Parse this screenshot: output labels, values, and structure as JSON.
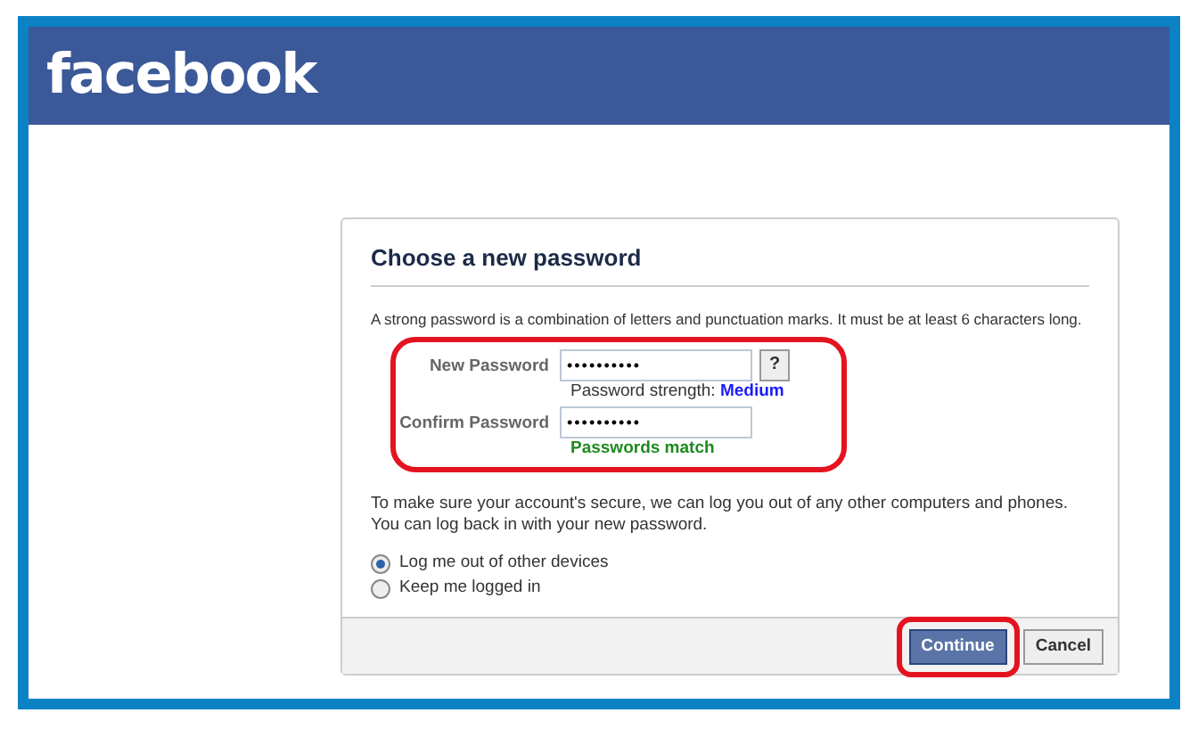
{
  "header": {
    "logo": "facebook"
  },
  "dialog": {
    "title": "Choose a new password",
    "intro": "A strong password is a combination of letters and punctuation marks. It must be at least 6 characters long.",
    "password_group": {
      "highlighted": true,
      "fields": [
        {
          "kind": "new",
          "label": "New Password",
          "value": "••••••••••",
          "help_button": "?",
          "hint_label": "Password strength:",
          "hint_value": "Medium"
        },
        {
          "kind": "confirm",
          "label": "Confirm Password",
          "value": "••••••••••",
          "hint_value": "Passwords match"
        }
      ]
    },
    "note": "To make sure your account's secure, we can log you out of any other computers and phones. You can log back in with your new password.",
    "options": [
      {
        "label": "Log me out of other devices",
        "selected": true
      },
      {
        "label": "Keep me logged in",
        "selected": false
      }
    ],
    "buttons": [
      {
        "label": "Continue",
        "kind": "primary",
        "highlighted": true
      },
      {
        "label": "Cancel",
        "kind": "secondary",
        "highlighted": false
      }
    ]
  }
}
